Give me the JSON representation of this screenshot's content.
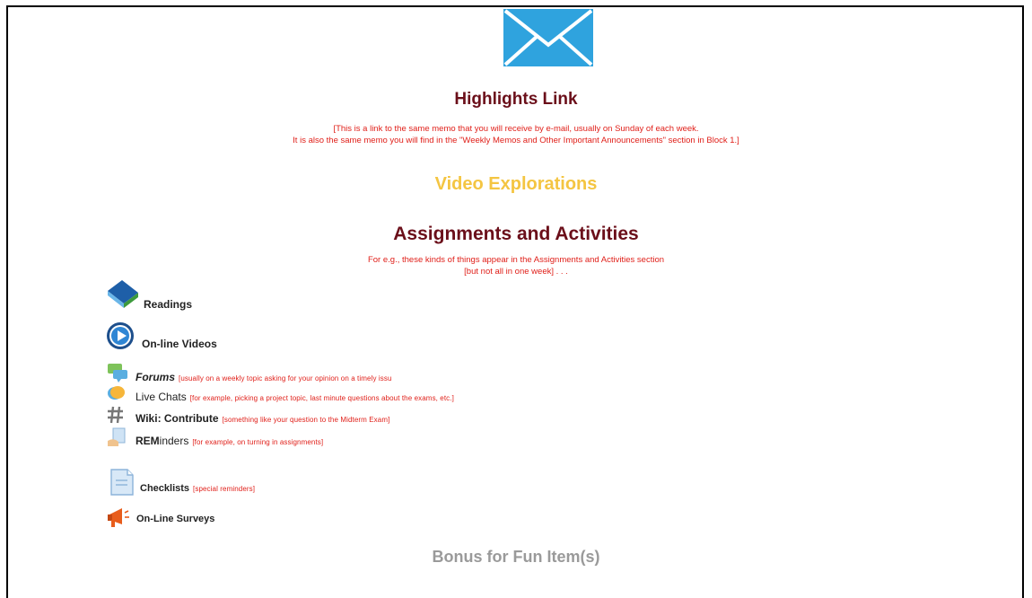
{
  "colors": {
    "maroon": "#6b0f1a",
    "note_red": "#e0201a",
    "video_yellow": "#f4c542",
    "bonus_grey": "#9a9a9a",
    "envelope_blue": "#2fa3de"
  },
  "header": {
    "icon": "envelope-icon",
    "highlights_title": "Highlights Link",
    "highlights_note_line1": "[This is a link to the same memo that you will receive by e-mail, usually on Sunday of each week.",
    "highlights_note_line2": "It is also the same memo you will find in the \"Weekly Memos and Other Important Announcements\" section in Block 1.]"
  },
  "video_explorations": "Video Explorations",
  "assignments": {
    "title": "Assignments and Activities",
    "note_line1": "For e.g., these kinds of things appear in the Assignments and Activities section",
    "note_line2": "[but not all in one week] . . ."
  },
  "items": [
    {
      "icon": "books-icon",
      "label": "Readings",
      "note": ""
    },
    {
      "icon": "play-icon",
      "label": "On-line Videos",
      "note": ""
    },
    {
      "icon": "forum-icon",
      "label": "Forums",
      "note": "[usually on a weekly topic asking for your opinion on a timely issu"
    },
    {
      "icon": "chat-icon",
      "label": "Live Chats",
      "note": "[for example, picking a project topic, last minute questions about the exams, etc.]"
    },
    {
      "icon": "wiki-icon",
      "label": "Wiki: Contribute",
      "note": "[something like your question to the Midterm Exam]"
    },
    {
      "icon": "reminder-icon",
      "label_bold": "REM",
      "label_rest": "inders",
      "note": "[for example, on turning in assignments]"
    },
    {
      "icon": "checklist-icon",
      "label": "Checklists",
      "note": "[special reminders]"
    },
    {
      "icon": "megaphone-icon",
      "label": "On-Line Surveys",
      "note": ""
    }
  ],
  "bonus": "Bonus for Fun Item(s)"
}
